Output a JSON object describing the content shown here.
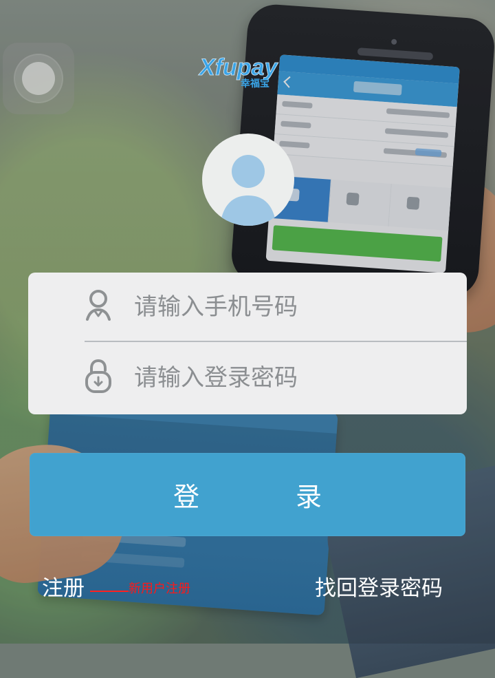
{
  "brand": {
    "logo_text": "Xfupay",
    "logo_subtitle": "幸福宝"
  },
  "login": {
    "phone_placeholder": "请输入手机号码",
    "password_placeholder": "请输入登录密码",
    "submit_label": "登 录"
  },
  "links": {
    "register": "注册",
    "register_note": "新用户注册",
    "forgot_password": "找回登录密码"
  },
  "colors": {
    "primary": "#41a2cf",
    "panel": "#eeeeef",
    "text_muted": "#8b8e91",
    "annotation": "#ff1818"
  },
  "icons": {
    "avatar": "user-avatar-icon",
    "phone": "user-icon",
    "password": "lock-icon",
    "assistive": "assistive-touch-icon"
  }
}
